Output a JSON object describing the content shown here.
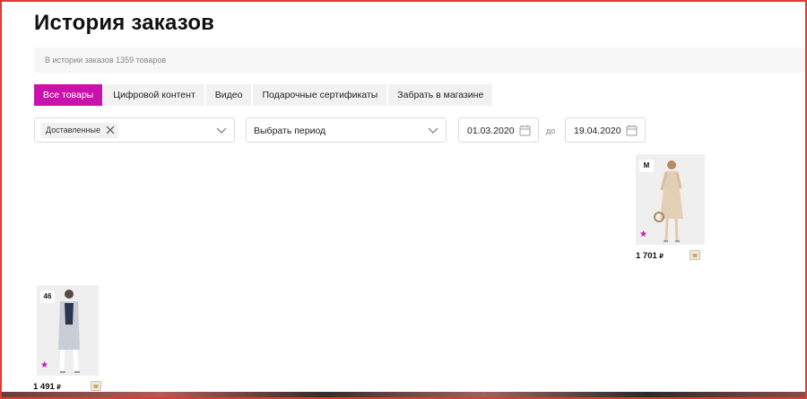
{
  "page": {
    "title": "История заказов",
    "summary": "В истории заказов 1359 товаров"
  },
  "tabs": [
    {
      "label": "Все товары",
      "active": true
    },
    {
      "label": "Цифровой контент",
      "active": false
    },
    {
      "label": "Видео",
      "active": false
    },
    {
      "label": "Подарочные сертификаты",
      "active": false
    },
    {
      "label": "Забрать в магазине",
      "active": false
    }
  ],
  "filters": {
    "status_chip": "Доставленные",
    "period_placeholder": "Выбрать период",
    "date_from": "01.03.2020",
    "date_to_label": "до",
    "date_to": "19.04.2020"
  },
  "products": [
    {
      "size": "M",
      "price": "1 701 ",
      "currency_glyph": "₽",
      "rating_icon": "star-icon",
      "photo_tone": "#e3cfb6"
    },
    {
      "size": "46",
      "price": "1 491 ",
      "currency_glyph": "₽",
      "rating_icon": "star-icon",
      "photo_tone": "#c9cdd6"
    }
  ],
  "colors": {
    "accent": "#cb11ab",
    "frame": "#e53935"
  }
}
